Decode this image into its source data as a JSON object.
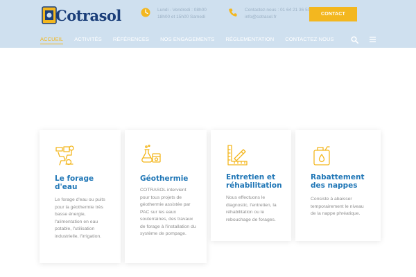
{
  "header": {
    "logo": {
      "text": "Cotrasol"
    },
    "hours": {
      "line1": "Lundi - Vendredi : 08h00",
      "line2": "18h00 et 15h00 Samedi"
    },
    "phone": {
      "line1": "Contactez-nous : 01 64 21 36 50",
      "line2": "info@cotrasol.fr"
    },
    "contact_label": "CONTACT",
    "nav": [
      "ACCUEIL",
      "ACTIVITÉS",
      "RÉFÉRENCES",
      "NOS ENGAGEMENTS",
      "RÉGLEMENTATION",
      "CONTACTEZ NOUS"
    ],
    "icons": {
      "search": "search-icon",
      "menu": "hamburger-menu-icon"
    }
  },
  "colors": {
    "accent": "#f3b71f",
    "heading": "#1f76b6",
    "header_bg": "#cfe0ef",
    "logo": "#1b3f7a"
  },
  "cards": [
    {
      "icon": "drilling-rig-icon",
      "title": "Le forage d'eau",
      "text": "Le forage d'eau ou puits pour la géothermie très basse énergie, l'alimentation en eau potable, l'utilisation industrielle, l'irrigation."
    },
    {
      "icon": "geothermal-chemistry-icon",
      "title": "Géothermie",
      "text": "COTRASOL intervient pour tous projets de géothermie assistée par PAC sur les eaux souterraines, des travaux de forage à l'installation du système de pompage."
    },
    {
      "icon": "ruler-tools-icon",
      "title": "Entretien et réhabilitation",
      "text": "Nous effectuons le diagnostic, l'entretien, la réhabilitation ou le rebouchage de forages."
    },
    {
      "icon": "water-canister-icon",
      "title": "Rabattement des nappes",
      "text": "Consiste à abaisser temporairement le niveau de la nappe phréatique."
    }
  ]
}
